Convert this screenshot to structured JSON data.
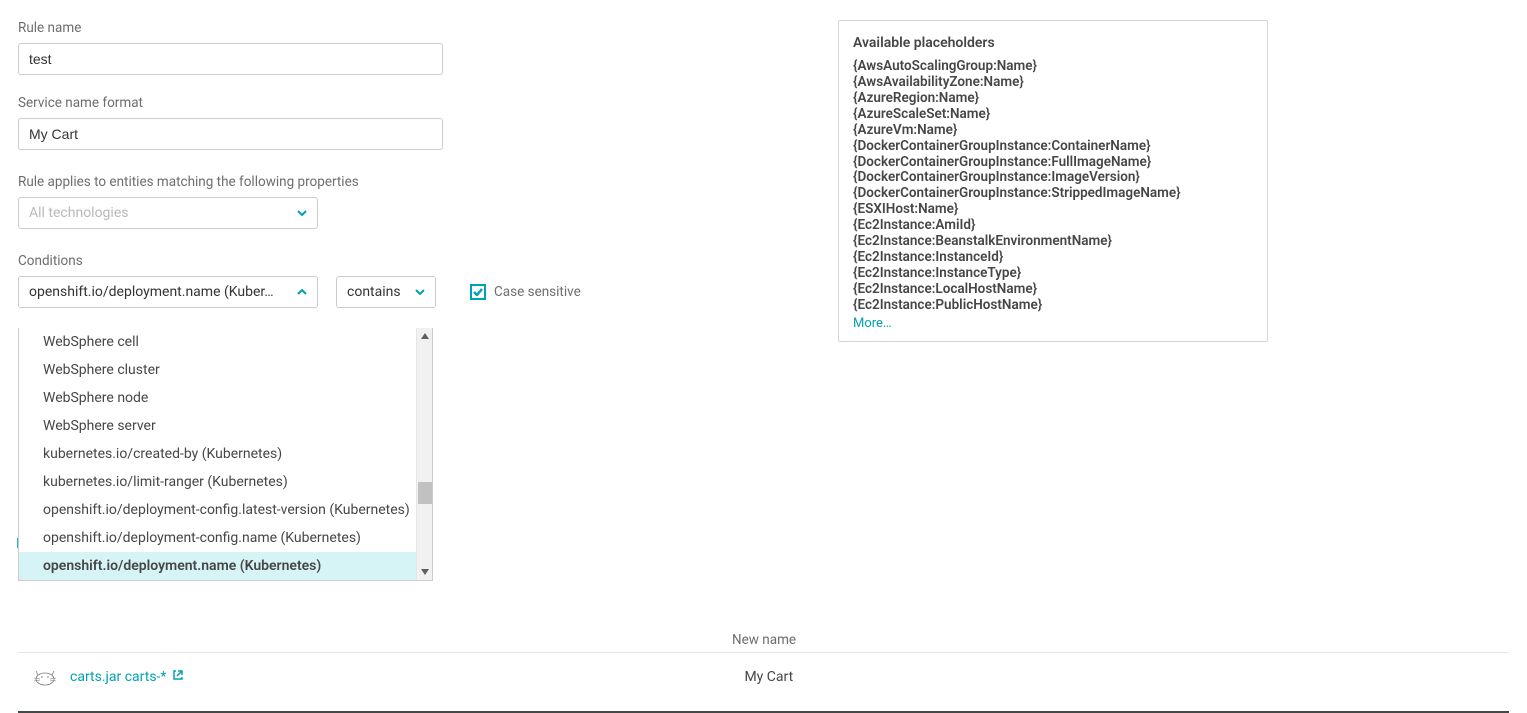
{
  "labels": {
    "rule_name": "Rule name",
    "service_name_format": "Service name format",
    "rule_applies": "Rule applies to entities matching the following properties",
    "conditions": "Conditions",
    "case_sensitive": "Case sensitive",
    "new_name_header": "New name"
  },
  "inputs": {
    "rule_name_value": "test",
    "service_name_format_value": "My Cart",
    "technologies_placeholder": "All technologies",
    "condition_selected": "openshift.io/deployment.name (Kuber…",
    "operator_selected": "contains"
  },
  "dropdown": {
    "items": [
      {
        "label": "WebSphere cell",
        "selected": false
      },
      {
        "label": "WebSphere cluster",
        "selected": false
      },
      {
        "label": "WebSphere node",
        "selected": false
      },
      {
        "label": "WebSphere server",
        "selected": false
      },
      {
        "label": "kubernetes.io/created-by (Kubernetes)",
        "selected": false
      },
      {
        "label": "kubernetes.io/limit-ranger (Kubernetes)",
        "selected": false
      },
      {
        "label": "openshift.io/deployment-config.latest-version (Kubernetes)",
        "selected": false
      },
      {
        "label": "openshift.io/deployment-config.name (Kubernetes)",
        "selected": false
      },
      {
        "label": "openshift.io/deployment.name (Kubernetes)",
        "selected": true
      }
    ]
  },
  "placeholders": {
    "title": "Available placeholders",
    "items": [
      "{AwsAutoScalingGroup:Name}",
      "{AwsAvailabilityZone:Name}",
      "{AzureRegion:Name}",
      "{AzureScaleSet:Name}",
      "{AzureVm:Name}",
      "{DockerContainerGroupInstance:ContainerName}",
      "{DockerContainerGroupInstance:FullImageName}",
      "{DockerContainerGroupInstance:ImageVersion}",
      "{DockerContainerGroupInstance:StrippedImageName}",
      "{ESXIHost:Name}",
      "{Ec2Instance:AmiId}",
      "{Ec2Instance:BeanstalkEnvironmentName}",
      "{Ec2Instance:InstanceId}",
      "{Ec2Instance:InstanceType}",
      "{Ec2Instance:LocalHostName}",
      "{Ec2Instance:PublicHostName}"
    ],
    "more": "More…"
  },
  "preview": {
    "link_text": "carts.jar carts-*",
    "new_name_value": "My Cart"
  },
  "stray": {
    "n": "N"
  }
}
